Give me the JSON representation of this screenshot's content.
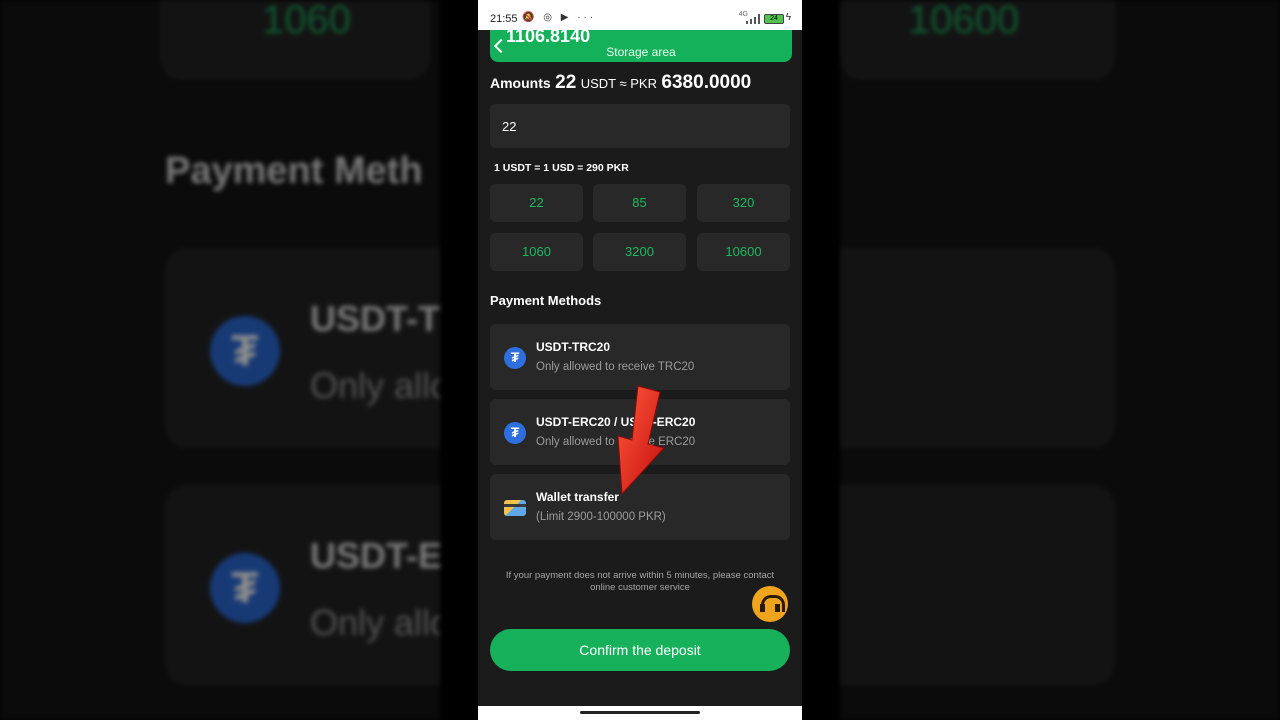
{
  "status_bar": {
    "time": "21:55",
    "icons": "🔕 ◎ ▶ ···",
    "network": "4G",
    "battery": "24"
  },
  "banner": {
    "balance": "1106.8140",
    "title": "Storage area"
  },
  "amounts": {
    "label": "Amounts",
    "value": "22",
    "usdt_unit": "USDT ≈ PKR",
    "pkr_value": "6380.0000"
  },
  "amount_input": {
    "value": "22"
  },
  "exchange_rate": "1 USDT = 1 USD = 290 PKR",
  "quick_amounts": [
    "22",
    "85",
    "320",
    "1060",
    "3200",
    "10600"
  ],
  "payment_methods": {
    "heading": "Payment Methods",
    "items": [
      {
        "title": "USDT-TRC20",
        "subtitle": "Only allowed to receive TRC20",
        "icon": "tether-icon"
      },
      {
        "title": "USDT-ERC20 / USDT-ERC20",
        "subtitle": "Only allowed to receive ERC20",
        "icon": "tether-icon"
      },
      {
        "title": "Wallet transfer",
        "subtitle": "(Limit 2900-100000 PKR)",
        "icon": "card-icon"
      }
    ]
  },
  "notice": "If your payment does not arrive within 5 minutes, please contact online customer service",
  "confirm_button": "Confirm the deposit",
  "background": {
    "left_number": "1060",
    "right_number": "10600",
    "heading": "Payment Meth",
    "method1_title": "USDT-T",
    "method1_sub": "Only allo",
    "method2_title": "USDT-E",
    "method2_sub": "Only allo"
  },
  "colors": {
    "accent": "#17b15c",
    "panel": "#282828",
    "background": "#1b1b1b",
    "tether": "#2f6fdd",
    "support": "#f0a31d"
  }
}
